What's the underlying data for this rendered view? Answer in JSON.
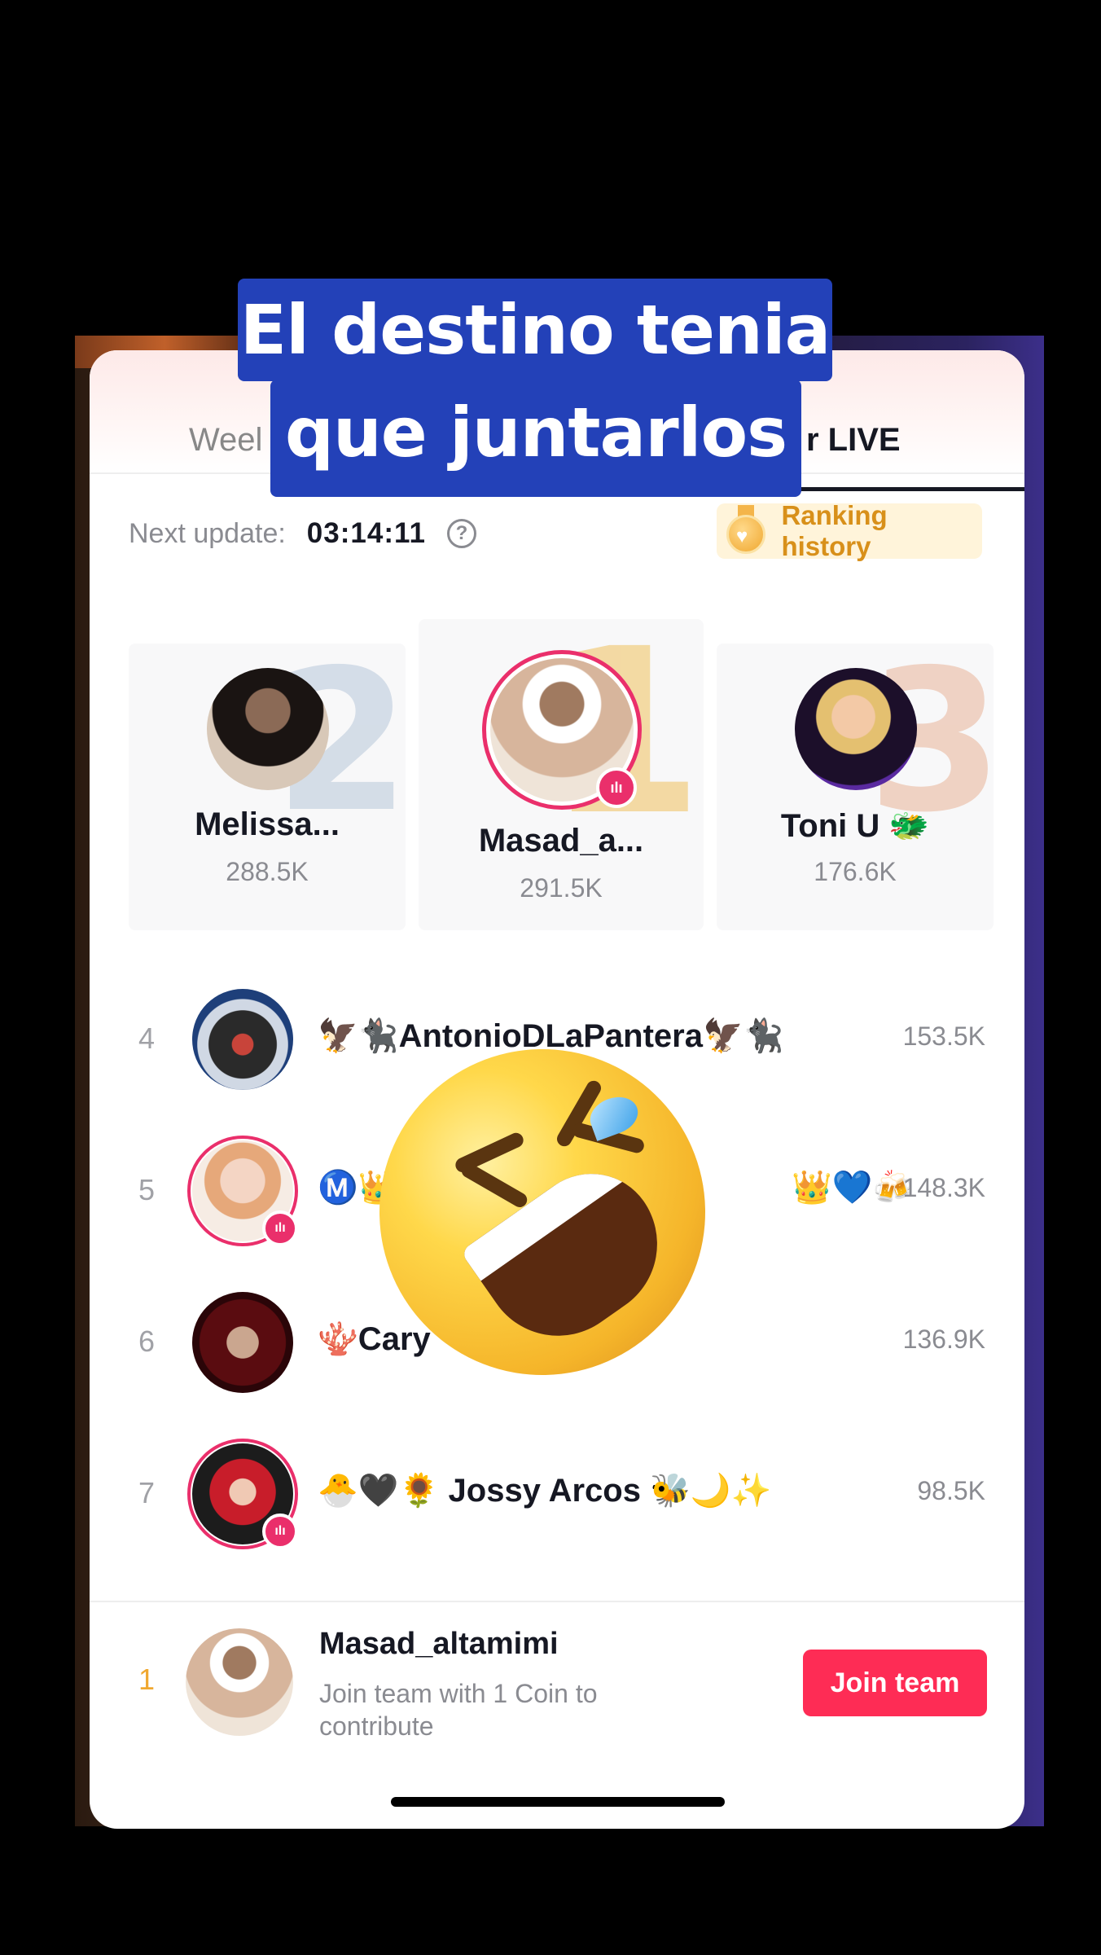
{
  "caption": {
    "line1": "El destino tenia",
    "line2": "que juntarlos"
  },
  "tabs": {
    "weekly": "Weel",
    "live": "r LIVE"
  },
  "update": {
    "label": "Next update:",
    "time": "03:14:11",
    "help": "?"
  },
  "ranking_history": "Ranking history",
  "podium": {
    "first": {
      "rank": "1",
      "name": "Masad_a...",
      "score": "291.5K"
    },
    "second": {
      "rank": "2",
      "name": "Melissa...",
      "score": "288.5K"
    },
    "third": {
      "rank": "3",
      "name": "Toni U 🐲",
      "score": "176.6K"
    }
  },
  "rows": [
    {
      "rank": "4",
      "name": "🦅🐈‍⬛AntonioDLaPantera🦅🐈‍⬛",
      "score": "153.5K",
      "live": false
    },
    {
      "rank": "5",
      "name": "Ⓜ️👑",
      "name_tail": "👑💙🍻",
      "score": "148.3K",
      "live": true
    },
    {
      "rank": "6",
      "name": "🪸Cary",
      "score": "136.9K",
      "live": false
    },
    {
      "rank": "7",
      "name": "🐣🖤🌻 Jossy Arcos 🐝🌙✨",
      "score": "98.5K",
      "live": true
    }
  ],
  "bottom": {
    "rank": "1",
    "name": "Masad_altamimi",
    "subtitle": "Join team with 1 Coin to contribute",
    "join_label": "Join team"
  }
}
